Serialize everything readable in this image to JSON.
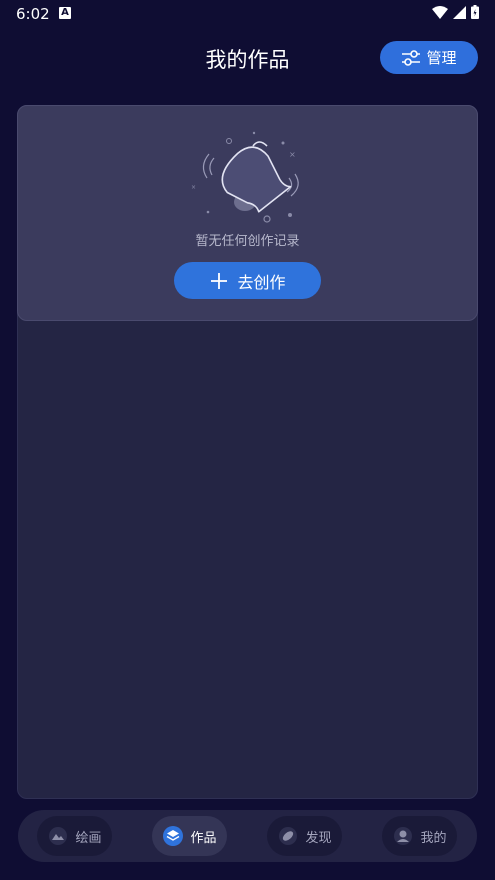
{
  "status_bar": {
    "time": "6:02",
    "notification_badge": "A",
    "icons": [
      "wifi-icon",
      "signal-icon",
      "battery-icon"
    ]
  },
  "header": {
    "title": "我的作品",
    "manage_label": "管理",
    "manage_icon": "sliders-icon"
  },
  "empty_state": {
    "message": "暂无任何创作记录",
    "create_label": "去创作",
    "illustration": "bell-icon"
  },
  "bottom_nav": {
    "items": [
      {
        "label": "绘画",
        "icon": "image-icon",
        "active": false
      },
      {
        "label": "作品",
        "icon": "layers-icon",
        "active": true
      },
      {
        "label": "发现",
        "icon": "compass-icon",
        "active": false
      },
      {
        "label": "我的",
        "icon": "person-icon",
        "active": false
      }
    ]
  },
  "colors": {
    "background": "#0f0d33",
    "panel": "#242544",
    "card": "#3b3b5d",
    "accent": "#2f73dc"
  }
}
